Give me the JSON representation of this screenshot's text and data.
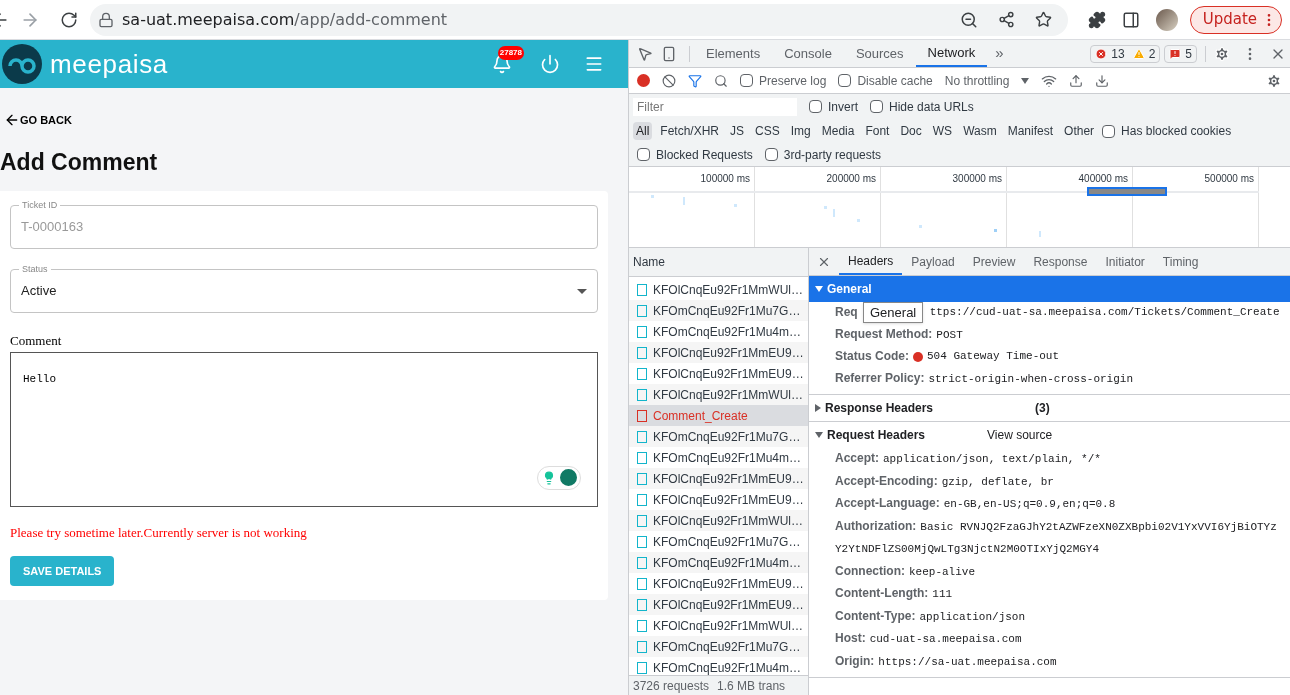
{
  "browser": {
    "url_host": "sa-uat.meepaisa.com",
    "url_path": "/app/add-comment",
    "forward_disabled": true,
    "update_label": "Update"
  },
  "app": {
    "brand": "meepaisa",
    "notification_count": "27878",
    "back_label": "GO BACK",
    "title": "Add Comment",
    "fields": [
      {
        "kind": "text",
        "label": "Ticket ID",
        "value": "T-0000163",
        "disabled": true
      },
      {
        "kind": "select",
        "label": "Status",
        "value": "Active",
        "disabled": false
      }
    ],
    "comment": {
      "label": "Comment",
      "value": "Hello"
    },
    "error": "Please try sometime later.Currently server is not working",
    "save_label": "SAVE DETAILS"
  },
  "devtools": {
    "tabs": [
      {
        "label": "Elements",
        "selected": false
      },
      {
        "label": "Console",
        "selected": false
      },
      {
        "label": "Sources",
        "selected": false
      },
      {
        "label": "Network",
        "selected": true
      }
    ],
    "more_tabs": "»",
    "errors": "13",
    "warnings": "2",
    "issues": "5",
    "throttling": "No throttling",
    "toolbar_checks": [
      {
        "label": "Preserve log",
        "checked": false
      },
      {
        "label": "Disable cache",
        "checked": false
      }
    ],
    "filter_placeholder": "Filter",
    "filter_checks": [
      {
        "label": "Invert",
        "checked": false
      },
      {
        "label": "Hide data URLs",
        "checked": false
      }
    ],
    "types": [
      {
        "label": "All",
        "selected": true
      },
      {
        "label": "Fetch/XHR",
        "selected": false
      },
      {
        "label": "JS",
        "selected": false
      },
      {
        "label": "CSS",
        "selected": false
      },
      {
        "label": "Img",
        "selected": false
      },
      {
        "label": "Media",
        "selected": false
      },
      {
        "label": "Font",
        "selected": false
      },
      {
        "label": "Doc",
        "selected": false
      },
      {
        "label": "WS",
        "selected": false
      },
      {
        "label": "Wasm",
        "selected": false
      },
      {
        "label": "Manifest",
        "selected": false
      },
      {
        "label": "Other",
        "selected": false
      }
    ],
    "type_checks": [
      {
        "label": "Has blocked cookies",
        "checked": false
      }
    ],
    "extra_checks": [
      {
        "label": "Blocked Requests",
        "checked": false
      },
      {
        "label": "3rd-party requests",
        "checked": false
      }
    ],
    "timeline_ticks": [
      "100000 ms",
      "200000 ms",
      "300000 ms",
      "400000 ms",
      "500000 ms"
    ],
    "list_header": "Name",
    "requests": [
      {
        "name": "KFOlCnqEu92Fr1MmWUl…",
        "failed": false,
        "selected": false
      },
      {
        "name": "KFOmCnqEu92Fr1Mu7G…",
        "failed": false,
        "selected": false
      },
      {
        "name": "KFOmCnqEu92Fr1Mu4m…",
        "failed": false,
        "selected": false
      },
      {
        "name": "KFOlCnqEu92Fr1MmEU9…",
        "failed": false,
        "selected": false
      },
      {
        "name": "KFOlCnqEu92Fr1MmEU9…",
        "failed": false,
        "selected": false
      },
      {
        "name": "KFOlCnqEu92Fr1MmWUl…",
        "failed": false,
        "selected": false
      },
      {
        "name": "Comment_Create",
        "failed": true,
        "selected": true
      },
      {
        "name": "KFOmCnqEu92Fr1Mu7G…",
        "failed": false,
        "selected": false
      },
      {
        "name": "KFOmCnqEu92Fr1Mu4m…",
        "failed": false,
        "selected": false
      },
      {
        "name": "KFOlCnqEu92Fr1MmEU9…",
        "failed": false,
        "selected": false
      },
      {
        "name": "KFOlCnqEu92Fr1MmEU9…",
        "failed": false,
        "selected": false
      },
      {
        "name": "KFOlCnqEu92Fr1MmWUl…",
        "failed": false,
        "selected": false
      },
      {
        "name": "KFOmCnqEu92Fr1Mu7G…",
        "failed": false,
        "selected": false
      },
      {
        "name": "KFOmCnqEu92Fr1Mu4m…",
        "failed": false,
        "selected": false
      },
      {
        "name": "KFOlCnqEu92Fr1MmEU9…",
        "failed": false,
        "selected": false
      },
      {
        "name": "KFOlCnqEu92Fr1MmEU9…",
        "failed": false,
        "selected": false
      },
      {
        "name": "KFOlCnqEu92Fr1MmWUl…",
        "failed": false,
        "selected": false
      },
      {
        "name": "KFOmCnqEu92Fr1Mu7G…",
        "failed": false,
        "selected": false
      },
      {
        "name": "KFOmCnqEu92Fr1Mu4m…",
        "failed": false,
        "selected": false
      }
    ],
    "footer": [
      "3726 requests",
      "1.6 MB trans"
    ],
    "detail_tabs": [
      {
        "label": "Headers",
        "selected": true
      },
      {
        "label": "Payload",
        "selected": false
      },
      {
        "label": "Preview",
        "selected": false
      },
      {
        "label": "Response",
        "selected": false
      },
      {
        "label": "Initiator",
        "selected": false
      },
      {
        "label": "Timing",
        "selected": false
      }
    ],
    "tooltip": "General",
    "sections": [
      {
        "title": "General",
        "expanded": true,
        "highlighted": true,
        "rows": [
          {
            "name": "Req",
            "value": "ttps://cud-uat-sa.meepaisa.com/Tickets/Comment_Create"
          },
          {
            "name": "Request Method:",
            "value": "POST"
          },
          {
            "name": "Status Code:",
            "value": "504 Gateway Time-out",
            "status_dot": true
          },
          {
            "name": "Referrer Policy:",
            "value": "strict-origin-when-cross-origin"
          }
        ]
      },
      {
        "title": "Response Headers",
        "expanded": false,
        "highlighted": false,
        "count": "(3)"
      },
      {
        "title": "Request Headers",
        "expanded": true,
        "highlighted": false,
        "link": "View source",
        "rows": [
          {
            "name": "Accept:",
            "value": "application/json, text/plain, */*"
          },
          {
            "name": "Accept-Encoding:",
            "value": "gzip, deflate, br"
          },
          {
            "name": "Accept-Language:",
            "value": "en-GB,en-US;q=0.9,en;q=0.8"
          },
          {
            "name": "Authorization:",
            "value": "Basic RVNJQ2FzaGJhY2tAZWFzeXN0ZXBpbi02V1YxVVI6YjBiOTYzY2YtNDFlZS00MjQwLTg3NjctN2M0OTIxYjQ2MGY4"
          },
          {
            "name": "Connection:",
            "value": "keep-alive"
          },
          {
            "name": "Content-Length:",
            "value": "111"
          },
          {
            "name": "Content-Type:",
            "value": "application/json"
          },
          {
            "name": "Host:",
            "value": "cud-uat-sa.meepaisa.com"
          },
          {
            "name": "Origin:",
            "value": "https://sa-uat.meepaisa.com"
          }
        ]
      }
    ]
  }
}
